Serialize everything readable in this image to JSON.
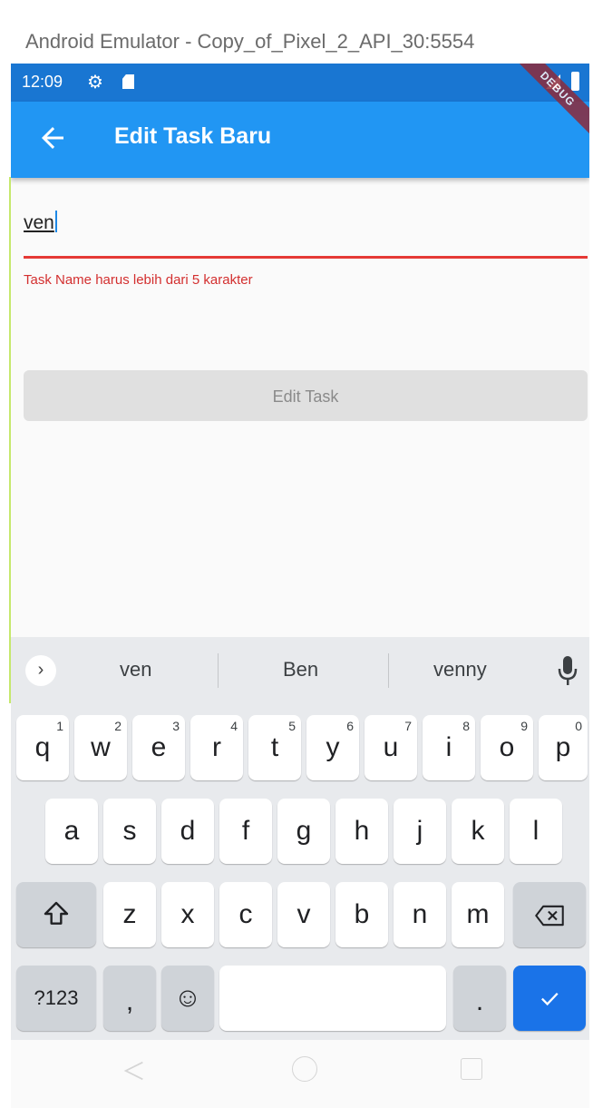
{
  "window": {
    "title": "Android Emulator - Copy_of_Pixel_2_API_30:5554"
  },
  "status_bar": {
    "time": "12:09",
    "icons": [
      "gear-icon",
      "sd-card-icon",
      "signal-icon",
      "battery-icon"
    ]
  },
  "app_bar": {
    "title": "Edit Task Baru",
    "back_icon": "arrow-left-icon",
    "debug_banner": "DEBUG",
    "color": "#2196f3"
  },
  "form": {
    "task_name_value": "ven",
    "error_message": "Task Name harus lebih dari 5 karakter",
    "error_color": "#e53935",
    "submit_label": "Edit Task"
  },
  "keyboard": {
    "suggestions": [
      "ven",
      "Ben",
      "venny"
    ],
    "row1": [
      {
        "key": "q",
        "hint": "1"
      },
      {
        "key": "w",
        "hint": "2"
      },
      {
        "key": "e",
        "hint": "3"
      },
      {
        "key": "r",
        "hint": "4"
      },
      {
        "key": "t",
        "hint": "5"
      },
      {
        "key": "y",
        "hint": "6"
      },
      {
        "key": "u",
        "hint": "7"
      },
      {
        "key": "i",
        "hint": "8"
      },
      {
        "key": "o",
        "hint": "9"
      },
      {
        "key": "p",
        "hint": "0"
      }
    ],
    "row2": [
      "a",
      "s",
      "d",
      "f",
      "g",
      "h",
      "j",
      "k",
      "l"
    ],
    "row3": [
      "z",
      "x",
      "c",
      "v",
      "b",
      "n",
      "m"
    ],
    "symbols_label": "?123",
    "comma": ",",
    "period": ".",
    "emoji": "☺",
    "accent_color": "#1a73e8"
  }
}
